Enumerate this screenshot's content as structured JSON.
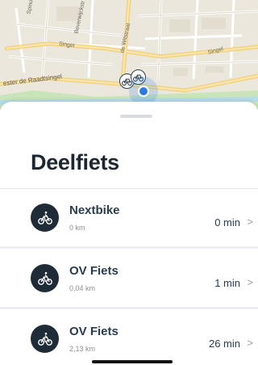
{
  "map": {
    "street_labels": {
      "spinoza": "Spinoz",
      "singel_a": "Singel",
      "bever": "Beverwijckstr",
      "witst": "de Witstraat",
      "singel_b": "Singel",
      "raadt": "ester de Raadtsingel"
    },
    "icons": {
      "bike_pin": "bicycle-icon",
      "location": "current-location-dot"
    },
    "colors": {
      "land": "#ece7dc",
      "road_major": "#f6d88a",
      "park": "#c9e4b8",
      "water": "#b7dbe8",
      "location": "#2d7be0"
    }
  },
  "sheet": {
    "title": "Deelfiets",
    "items": [
      {
        "name": "Nextbike",
        "distance": "0 km",
        "time": "0 min",
        "icon": "bicycle-icon"
      },
      {
        "name": "OV Fiets",
        "distance": "0,04 km",
        "time": "1 min",
        "icon": "bicycle-icon"
      },
      {
        "name": "OV Fiets",
        "distance": "2,13 km",
        "time": "26 min",
        "icon": "bicycle-icon"
      }
    ],
    "chevron": ">"
  }
}
